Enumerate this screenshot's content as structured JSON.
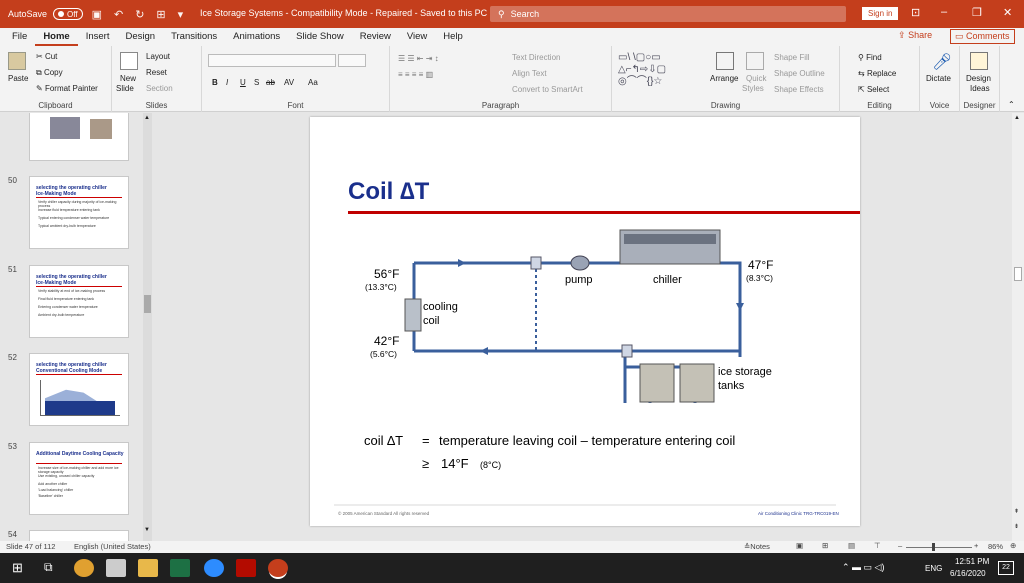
{
  "titlebar": {
    "autosave": "AutoSave",
    "autosave_state": "Off",
    "doc_title": "Ice Storage Systems  -  Compatibility Mode  -  Repaired  -  Saved to this PC",
    "search_placeholder": "Search",
    "signin": "Sign in",
    "accent": "#c43e1c"
  },
  "menu": {
    "tabs": [
      "File",
      "Home",
      "Insert",
      "Design",
      "Transitions",
      "Animations",
      "Slide Show",
      "Review",
      "View",
      "Help"
    ],
    "active": "Home",
    "share": "Share",
    "comments": "Comments"
  },
  "ribbon": {
    "clipboard": {
      "paste": "Paste",
      "cut": "Cut",
      "copy": "Copy",
      "format_painter": "Format Painter",
      "label": "Clipboard"
    },
    "slides": {
      "new_slide": "New",
      "new_slide2": "Slide",
      "layout": "Layout",
      "reset": "Reset",
      "section": "Section",
      "label": "Slides"
    },
    "font": {
      "label": "Font",
      "bold": "B",
      "italic": "I",
      "underline": "U",
      "shadow": "S",
      "strike": "ab",
      "spacing": "AV",
      "case": "Aa"
    },
    "paragraph": {
      "label": "Paragraph",
      "text_direction": "Text Direction",
      "align_text": "Align Text",
      "smartart": "Convert to SmartArt"
    },
    "drawing": {
      "label": "Drawing",
      "arrange": "Arrange",
      "quick_styles": "Quick",
      "quick_styles2": "Styles",
      "shape_fill": "Shape Fill",
      "shape_outline": "Shape Outline",
      "shape_effects": "Shape Effects"
    },
    "editing": {
      "label": "Editing",
      "find": "Find",
      "replace": "Replace",
      "select": "Select"
    },
    "voice": {
      "label": "Voice",
      "dictate": "Dictate"
    },
    "designer": {
      "label": "Designer",
      "design_ideas": "Design",
      "design_ideas2": "Ideas"
    }
  },
  "thumbnails": [
    {
      "num": "",
      "title": "",
      "bullets": []
    },
    {
      "num": "50",
      "title": "selecting the operating chiller\nIce-Making Mode",
      "bullets": [
        "Verify chiller capacity during majority of ice-making process",
        "Increase fluid temperature entering tank",
        "Typical entering condenser water temperature",
        "Typical ambient dry-bulb temperature"
      ]
    },
    {
      "num": "51",
      "title": "selecting the operating chiller\nIce-Making Mode",
      "bullets": [
        "Verify stability at end of ice-making process",
        "Final fluid temperature entering tank",
        "Entering condenser water temperature",
        "Ambient dry-bulb temperature"
      ]
    },
    {
      "num": "52",
      "title": "selecting the operating chiller\nConventional Cooling Mode",
      "bullets": []
    },
    {
      "num": "53",
      "title": "Additional Daytime Cooling Capacity",
      "bullets": [
        "Increase size of ice-making chiller and add more ice storage capacity",
        "Use existing, unused chiller capacity",
        "Add another chiller",
        "'Load balancing' chiller",
        "'Baseline' chiller"
      ]
    },
    {
      "num": "54",
      "title": "",
      "bullets": []
    }
  ],
  "slide": {
    "title": "Coil ∆T",
    "labels": {
      "t_hot_f": "56°F",
      "t_hot_c": "(13.3°C)",
      "t_cold_f": "42°F",
      "t_cold_c": "(5.6°C)",
      "chiller_out_f": "47°F",
      "chiller_out_c": "(8.3°C)",
      "pump": "pump",
      "chiller": "chiller",
      "cooling": "cooling",
      "coil": "coil",
      "ice1": "ice storage",
      "ice2": "tanks"
    },
    "formula": {
      "lhs": "coil ∆T",
      "eq": "=",
      "rhs": "temperature leaving coil – temperature entering coil",
      "ge": "≥",
      "value": "14°F",
      "value_c": "(8°C)"
    },
    "footer_left": "© 2005 American Standard   All rights reserved",
    "footer_right": "Air Conditioning Clinic TRG-TRC019-EN",
    "colors": {
      "title": "#1a2f8c",
      "rule": "#c00000",
      "pipe": "#3a5f9c"
    }
  },
  "status": {
    "slide_of": "Slide 47 of 112",
    "language": "English (United States)",
    "notes": "Notes",
    "zoom": "86%"
  },
  "taskbar": {
    "time": "12:51 PM",
    "date": "6/16/2020",
    "lang": "ENG",
    "notif": "22"
  }
}
